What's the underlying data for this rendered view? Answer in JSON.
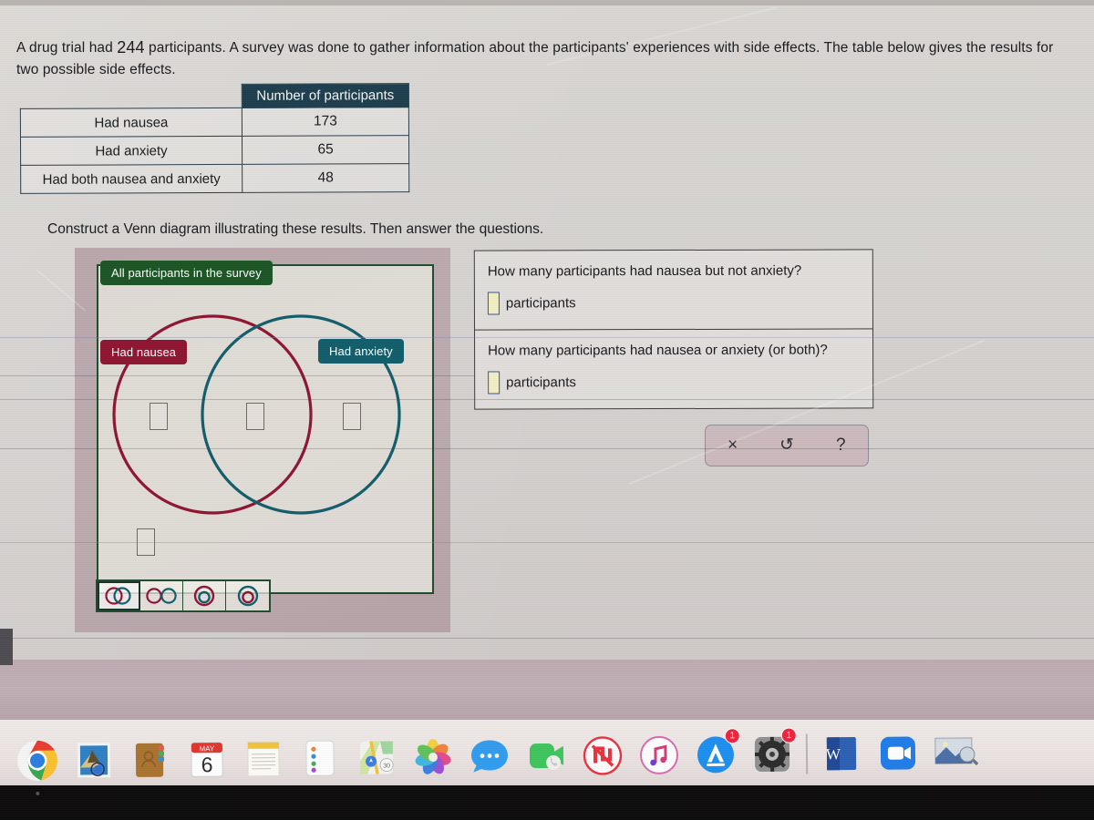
{
  "problem": {
    "text_before_number": "A drug trial had ",
    "participant_count": "244",
    "text_after_number": " participants. A survey was done to gather information about the participants' experiences with side effects. The table below gives the results for two possible side effects.",
    "instruction": "Construct a Venn diagram illustrating these results. Then answer the questions."
  },
  "table": {
    "header_blank": "",
    "header_value": "Number of participants",
    "rows": [
      {
        "label": "Had nausea",
        "value": "173"
      },
      {
        "label": "Had anxiety",
        "value": "65"
      },
      {
        "label": "Had both nausea and anxiety",
        "value": "48"
      }
    ]
  },
  "venn": {
    "universe_label": "All participants in the survey",
    "left_label": "Had nausea",
    "right_label": "Had anxiety",
    "left_only_value": "",
    "intersection_value": "",
    "right_only_value": "",
    "outside_value": "",
    "colors": {
      "universe": "#1b5424",
      "left_circle": "#8e1331",
      "right_circle": "#105c6b",
      "panel_background": "#b9a6ab",
      "inner_background": "#e8e7de"
    },
    "shape_options": [
      {
        "name": "overlapping-circles",
        "selected": true
      },
      {
        "name": "disjoint-circles",
        "selected": false
      },
      {
        "name": "right-inside-left",
        "selected": false
      },
      {
        "name": "left-inside-right",
        "selected": false
      }
    ]
  },
  "questions": [
    {
      "prompt": "How many participants had nausea but not anxiety?",
      "answer_value": "",
      "unit": "participants"
    },
    {
      "prompt": "How many participants had nausea or anxiety (or both)?",
      "answer_value": "",
      "unit": "participants"
    }
  ],
  "actions": [
    {
      "name": "clear-button",
      "glyph": "×"
    },
    {
      "name": "undo-button",
      "glyph": "↺"
    },
    {
      "name": "help-button",
      "glyph": "?"
    }
  ],
  "dock": {
    "items": [
      {
        "name": "chrome",
        "label": "Google Chrome",
        "badge": ""
      },
      {
        "name": "mail",
        "label": "Mail",
        "badge": ""
      },
      {
        "name": "contacts",
        "label": "Contacts",
        "badge": ""
      },
      {
        "name": "calendar",
        "label": "Calendar",
        "month": "MAY",
        "day": "6",
        "badge": ""
      },
      {
        "name": "notes",
        "label": "Notes",
        "badge": ""
      },
      {
        "name": "reminders",
        "label": "Reminders",
        "badge": ""
      },
      {
        "name": "maps",
        "label": "Maps",
        "badge": ""
      },
      {
        "name": "photos",
        "label": "Photos",
        "badge": ""
      },
      {
        "name": "messages",
        "label": "Messages",
        "badge": ""
      },
      {
        "name": "facetime",
        "label": "FaceTime",
        "badge": ""
      },
      {
        "name": "news",
        "label": "News",
        "badge": ""
      },
      {
        "name": "music",
        "label": "Music",
        "badge": ""
      },
      {
        "name": "app-store",
        "label": "App Store",
        "badge": "1"
      },
      {
        "name": "system-preferences",
        "label": "System Preferences",
        "badge": "1"
      },
      {
        "name": "word",
        "label": "Microsoft Word",
        "letter": "W",
        "badge": ""
      },
      {
        "name": "zoom",
        "label": "Zoom",
        "badge": ""
      },
      {
        "name": "preview",
        "label": "Preview",
        "badge": ""
      }
    ]
  }
}
